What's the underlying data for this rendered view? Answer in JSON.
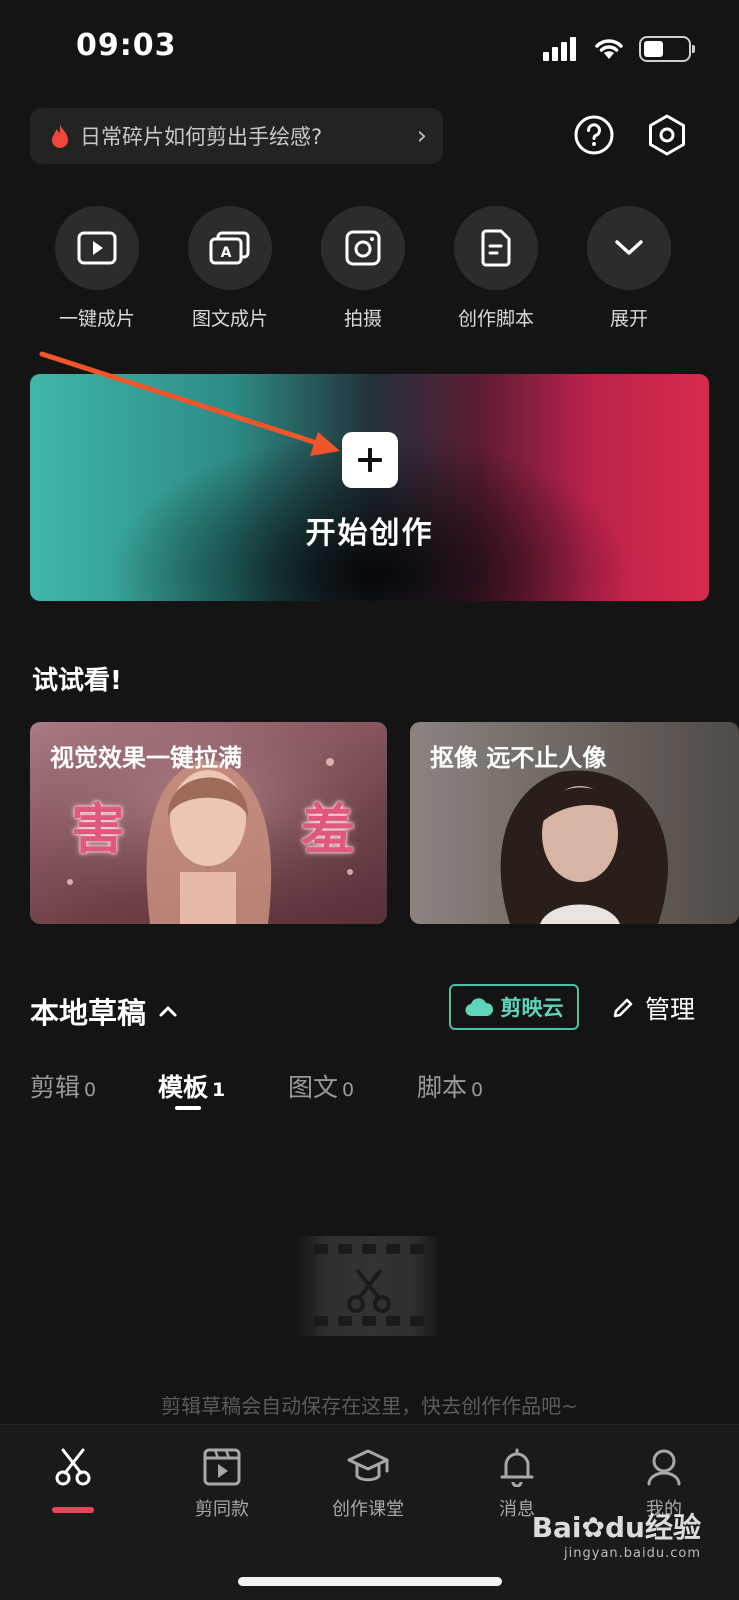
{
  "status_bar": {
    "time": "09:03"
  },
  "tip": {
    "text": "日常碎片如何剪出手绘感?"
  },
  "quick_actions": [
    {
      "label": "一键成片",
      "icon": "play-box-icon"
    },
    {
      "label": "图文成片",
      "icon": "text-to-video-icon"
    },
    {
      "label": "拍摄",
      "icon": "camera-icon"
    },
    {
      "label": "创作脚本",
      "icon": "script-document-icon"
    },
    {
      "label": "展开",
      "icon": "chevron-down-icon"
    }
  ],
  "banner": {
    "label": "开始创作"
  },
  "try_section": {
    "title": "试试看!",
    "cards": [
      {
        "title": "视觉效果一键拉满",
        "overlay_chars": [
          "害",
          "羞"
        ]
      },
      {
        "title": "抠像 远不止人像"
      }
    ]
  },
  "drafts": {
    "title": "本地草稿",
    "cloud_label": "剪映云",
    "manage_label": "管理",
    "tabs": [
      {
        "label": "剪辑",
        "count": "0",
        "active": false
      },
      {
        "label": "模板",
        "count": "1",
        "active": true
      },
      {
        "label": "图文",
        "count": "0",
        "active": false
      },
      {
        "label": "脚本",
        "count": "0",
        "active": false
      }
    ],
    "empty_text": "剪辑草稿会自动保存在这里，快去创作作品吧~"
  },
  "bottom_nav": [
    {
      "label": "",
      "icon": "scissors-icon",
      "active": true
    },
    {
      "label": "剪同款",
      "icon": "template-play-icon",
      "active": false
    },
    {
      "label": "创作课堂",
      "icon": "graduation-cap-icon",
      "active": false
    },
    {
      "label": "消息",
      "icon": "bell-icon",
      "active": false
    },
    {
      "label": "我的",
      "icon": "profile-icon",
      "active": false
    }
  ],
  "watermark": {
    "text": "Bai",
    "text2": "du",
    "text3": "经验",
    "sub": "jingyan.baidu.com"
  },
  "colors": {
    "accent_red": "#e8455a",
    "cloud_teal": "#46c2a6",
    "background": "#141414"
  }
}
